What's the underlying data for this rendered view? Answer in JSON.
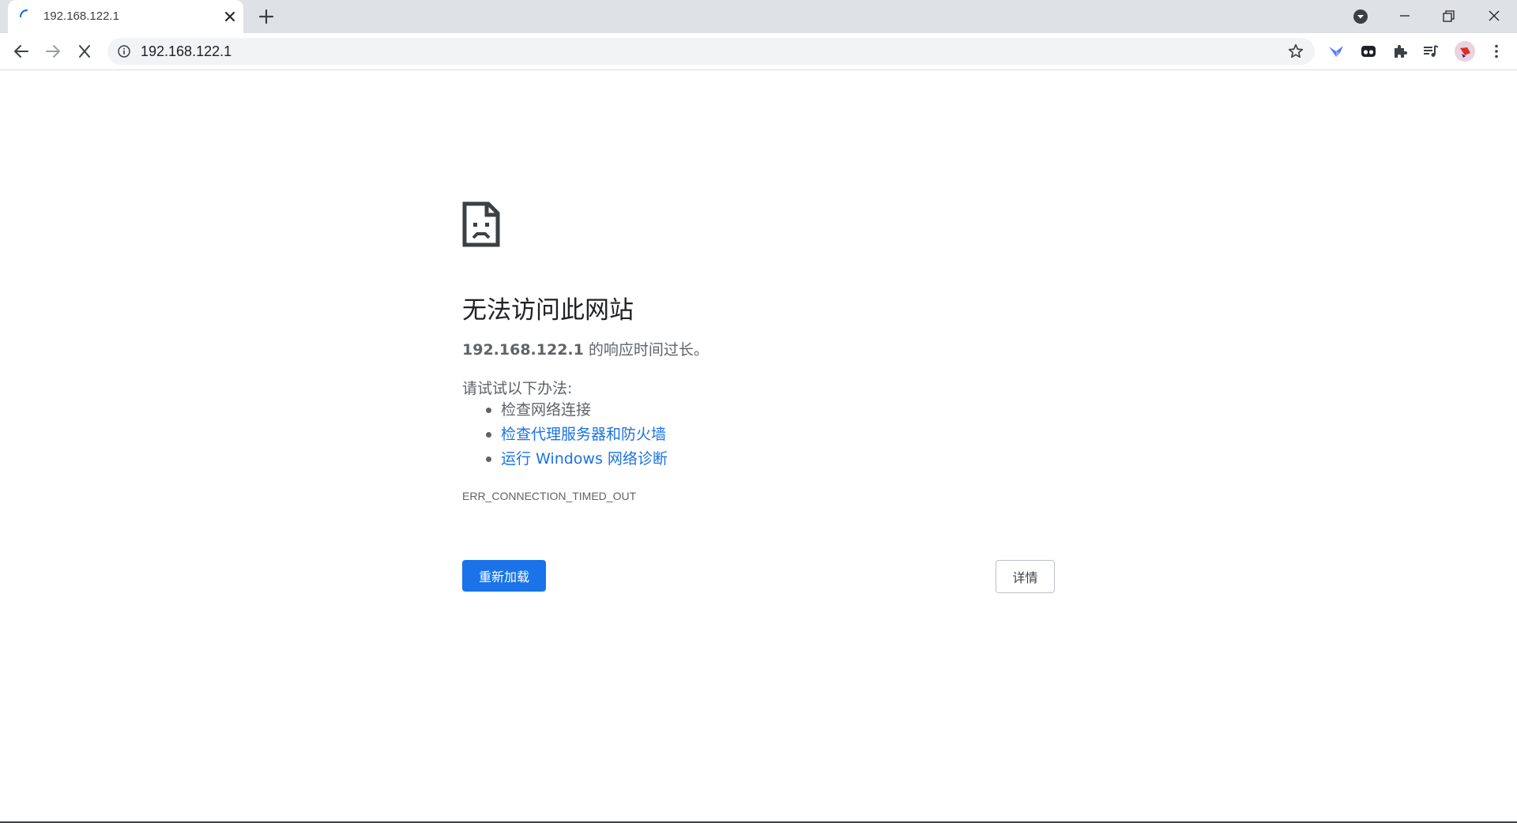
{
  "tab": {
    "title": "192.168.122.1",
    "loading": true
  },
  "toolbar": {
    "url": "192.168.122.1"
  },
  "error": {
    "title": "无法访问此网站",
    "host": "192.168.122.1",
    "message_suffix": " 的响应时间过长。",
    "try_heading": "请试试以下办法:",
    "suggestions": [
      {
        "label": "检查网络连接",
        "link": false
      },
      {
        "label": "检查代理服务器和防火墙",
        "link": true
      },
      {
        "label": "运行 Windows 网络诊断",
        "link": true
      }
    ],
    "code": "ERR_CONNECTION_TIMED_OUT",
    "reload_label": "重新加载",
    "details_label": "详情"
  },
  "colors": {
    "accent": "#1a73e8",
    "tabstrip": "#dee1e6",
    "text_secondary": "#5f6368"
  }
}
